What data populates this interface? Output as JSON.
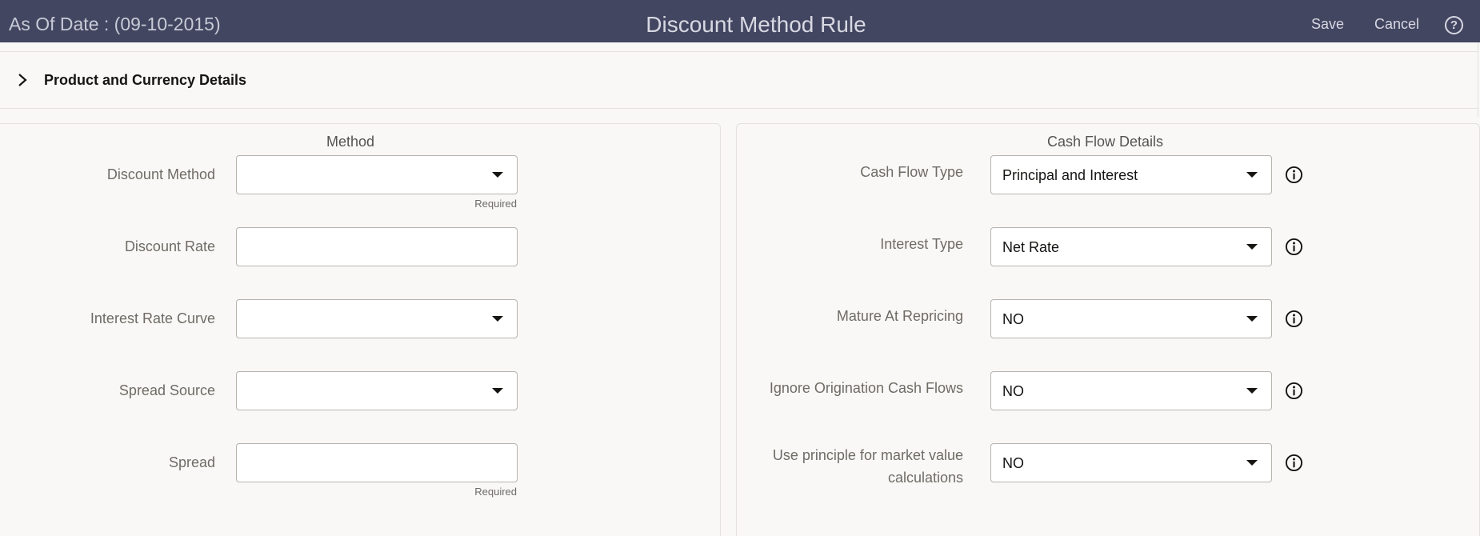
{
  "header": {
    "as_of_date": "As Of Date : (09-10-2015)",
    "title": "Discount Method Rule",
    "save_label": "Save",
    "cancel_label": "Cancel",
    "help_icon": "question-circle-icon"
  },
  "product_section": {
    "label": "Product and Currency Details",
    "icon": "chevron-right-icon"
  },
  "method_panel": {
    "title": "Method",
    "fields": [
      {
        "label": "Discount Method",
        "value": "",
        "type": "select",
        "hint": "Required"
      },
      {
        "label": "Discount Rate",
        "value": "",
        "type": "text",
        "hint": ""
      },
      {
        "label": "Interest Rate Curve",
        "value": "",
        "type": "select",
        "hint": ""
      },
      {
        "label": "Spread Source",
        "value": "",
        "type": "select",
        "hint": ""
      },
      {
        "label": "Spread",
        "value": "",
        "type": "text",
        "hint": "Required"
      }
    ]
  },
  "cashflow_panel": {
    "title": "Cash Flow Details",
    "fields": [
      {
        "label": "Cash Flow Type",
        "value": "Principal and Interest",
        "type": "select"
      },
      {
        "label": "Interest Type",
        "value": "Net Rate",
        "type": "select"
      },
      {
        "label": "Mature At Repricing",
        "value": "NO",
        "type": "select"
      },
      {
        "label": "Ignore Origination Cash Flows",
        "value": "NO",
        "type": "select"
      },
      {
        "label_line1": "Use principle for market value",
        "label_line2": "calculations",
        "value": "NO",
        "type": "select"
      }
    ],
    "info_icon": "info-circle-icon"
  },
  "colors": {
    "header_bg": "#434661",
    "page_bg": "#f9f8f6",
    "field_border": "#b7b3ad"
  }
}
